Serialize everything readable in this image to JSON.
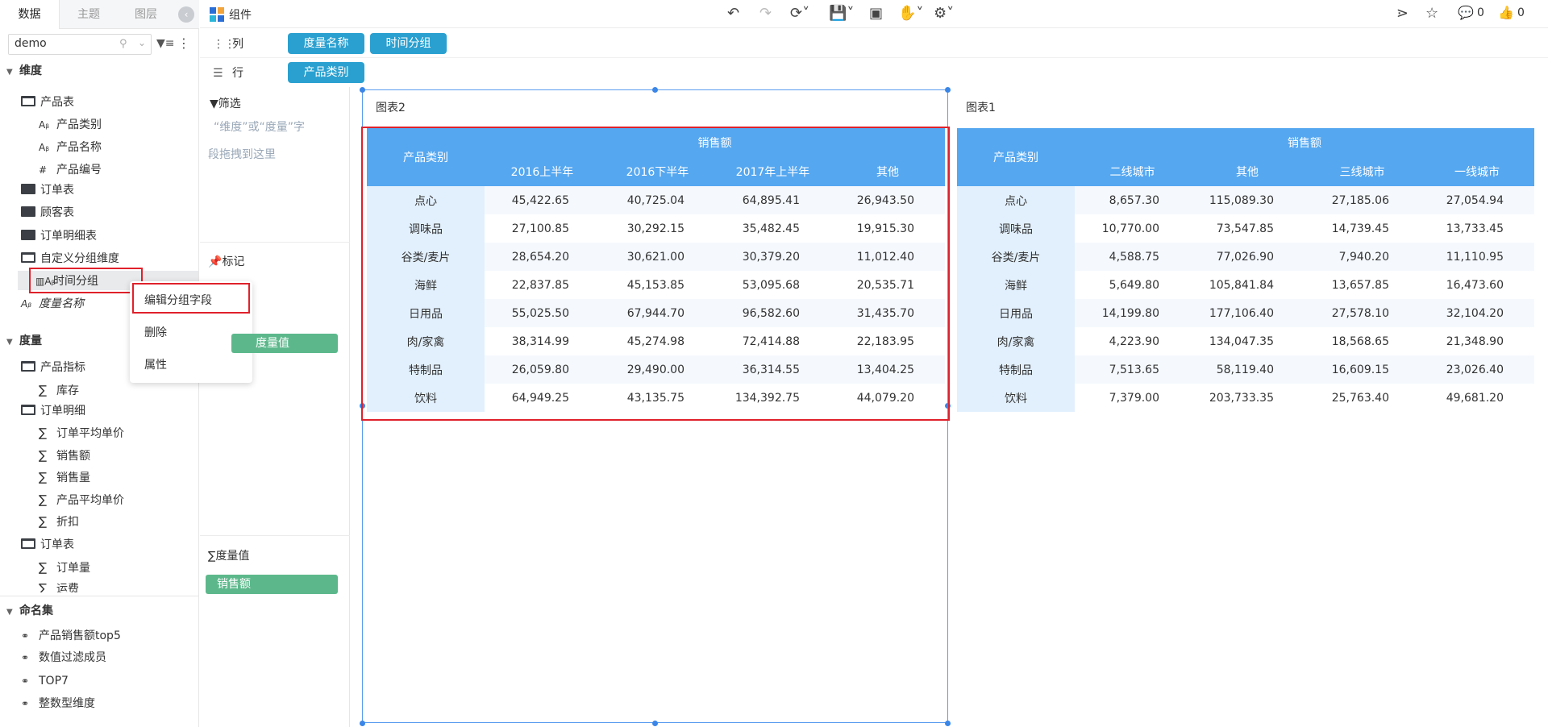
{
  "left_panel": {
    "tabs": [
      "数据",
      "主题",
      "图层"
    ],
    "search_value": "demo",
    "dimensions_title": "维度",
    "dimensions": [
      {
        "label": "产品表",
        "type": "folder-open"
      },
      {
        "label": "产品类别",
        "type": "text"
      },
      {
        "label": "产品名称",
        "type": "text"
      },
      {
        "label": "产品编号",
        "type": "number"
      },
      {
        "label": "订单表",
        "type": "folder"
      },
      {
        "label": "顾客表",
        "type": "folder"
      },
      {
        "label": "订单明细表",
        "type": "folder"
      },
      {
        "label": "自定义分组维度",
        "type": "folder-open"
      },
      {
        "label": "时间分组",
        "type": "group"
      },
      {
        "label": "度量名称",
        "type": "text-italic"
      }
    ],
    "measures_title": "度量",
    "measures": [
      {
        "label": "产品指标",
        "type": "folder-open"
      },
      {
        "label": "库存",
        "type": "sum"
      },
      {
        "label": "订单明细",
        "type": "folder-open"
      },
      {
        "label": "订单平均单价",
        "type": "sum"
      },
      {
        "label": "销售额",
        "type": "sum"
      },
      {
        "label": "销售量",
        "type": "sum"
      },
      {
        "label": "产品平均单价",
        "type": "sum"
      },
      {
        "label": "折扣",
        "type": "sum"
      },
      {
        "label": "订单表",
        "type": "folder-open"
      },
      {
        "label": "订单量",
        "type": "sum"
      },
      {
        "label": "运费",
        "type": "sum"
      }
    ],
    "named_sets_title": "命名集",
    "named_sets": [
      "产品销售额top5",
      "数值过滤成员",
      "TOP7",
      "整数型维度"
    ]
  },
  "context_menu": {
    "items": [
      "编辑分组字段",
      "删除",
      "属性"
    ]
  },
  "toolbar": {
    "component_label": "组件",
    "comment_count": "0",
    "like_count": "0"
  },
  "shelves": {
    "columns_label": "列",
    "columns": [
      "度量名称",
      "时间分组"
    ],
    "rows_label": "行",
    "rows": [
      "产品类别"
    ]
  },
  "mid_panel": {
    "filter_label": "筛选",
    "filter_hint_1": "“维度”或“度量”字",
    "filter_hint_2": "段拖拽到这里",
    "marks_label": "标记",
    "measure_value_pill": "度量值",
    "measure_values_label": "度量值",
    "measure_values": [
      "销售额"
    ]
  },
  "chart_data": [
    {
      "type": "table",
      "title": "图表2",
      "row_header": "产品类别",
      "measure_header": "销售额",
      "columns": [
        "2016上半年",
        "2016下半年",
        "2017年上半年",
        "其他"
      ],
      "rows": [
        {
          "category": "点心",
          "values": [
            "45,422.65",
            "40,725.04",
            "64,895.41",
            "26,943.50"
          ]
        },
        {
          "category": "调味品",
          "values": [
            "27,100.85",
            "30,292.15",
            "35,482.45",
            "19,915.30"
          ]
        },
        {
          "category": "谷类/麦片",
          "values": [
            "28,654.20",
            "30,621.00",
            "30,379.20",
            "11,012.40"
          ]
        },
        {
          "category": "海鲜",
          "values": [
            "22,837.85",
            "45,153.85",
            "53,095.68",
            "20,535.71"
          ]
        },
        {
          "category": "日用品",
          "values": [
            "55,025.50",
            "67,944.70",
            "96,582.60",
            "31,435.70"
          ]
        },
        {
          "category": "肉/家禽",
          "values": [
            "38,314.99",
            "45,274.98",
            "72,414.88",
            "22,183.95"
          ]
        },
        {
          "category": "特制品",
          "values": [
            "26,059.80",
            "29,490.00",
            "36,314.55",
            "13,404.25"
          ]
        },
        {
          "category": "饮料",
          "values": [
            "64,949.25",
            "43,135.75",
            "134,392.75",
            "44,079.20"
          ]
        }
      ]
    },
    {
      "type": "table",
      "title": "图表1",
      "row_header": "产品类别",
      "measure_header": "销售额",
      "columns": [
        "二线城市",
        "其他",
        "三线城市",
        "一线城市"
      ],
      "rows": [
        {
          "category": "点心",
          "values": [
            "8,657.30",
            "115,089.30",
            "27,185.06",
            "27,054.94"
          ]
        },
        {
          "category": "调味品",
          "values": [
            "10,770.00",
            "73,547.85",
            "14,739.45",
            "13,733.45"
          ]
        },
        {
          "category": "谷类/麦片",
          "values": [
            "4,588.75",
            "77,026.90",
            "7,940.20",
            "11,110.95"
          ]
        },
        {
          "category": "海鲜",
          "values": [
            "5,649.80",
            "105,841.84",
            "13,657.85",
            "16,473.60"
          ]
        },
        {
          "category": "日用品",
          "values": [
            "14,199.80",
            "177,106.40",
            "27,578.10",
            "32,104.20"
          ]
        },
        {
          "category": "肉/家禽",
          "values": [
            "4,223.90",
            "134,047.35",
            "18,568.65",
            "21,348.90"
          ]
        },
        {
          "category": "特制品",
          "values": [
            "7,513.65",
            "58,119.40",
            "16,609.15",
            "23,026.40"
          ]
        },
        {
          "category": "饮料",
          "values": [
            "7,379.00",
            "203,733.35",
            "25,763.40",
            "49,681.20"
          ]
        }
      ]
    }
  ]
}
